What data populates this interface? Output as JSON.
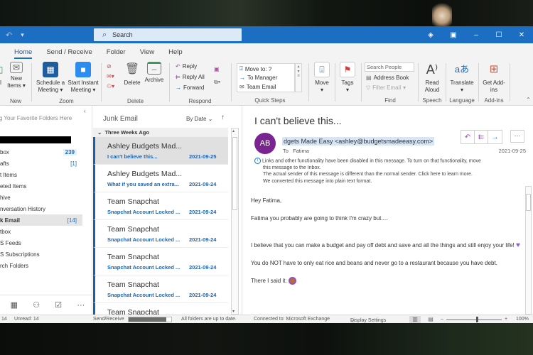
{
  "titlebar": {
    "search_placeholder": "Search",
    "icons": [
      "undo-icon",
      "customize-toolbar-icon",
      "diamond-icon",
      "ribbon-display-icon",
      "minimize-icon",
      "maximize-icon",
      "close-icon"
    ]
  },
  "tabs": [
    {
      "label": "Home",
      "active": true
    },
    {
      "label": "Send / Receive",
      "active": false
    },
    {
      "label": "Folder",
      "active": false
    },
    {
      "label": "View",
      "active": false
    },
    {
      "label": "Help",
      "active": false
    }
  ],
  "ribbon": {
    "new": {
      "group": "New",
      "new_items": "New Items",
      "new_email_partial": "l"
    },
    "zoom": {
      "group": "Zoom",
      "schedule": "Schedule a Meeting",
      "start_instant": "Start Instant Meeting"
    },
    "delete": {
      "group": "Delete",
      "delete": "Delete",
      "archive": "Archive"
    },
    "respond": {
      "group": "Respond",
      "reply": "Reply",
      "reply_all": "Reply All",
      "forward": "Forward"
    },
    "quick_steps": {
      "group": "Quick Steps",
      "items": [
        "Move to: ?",
        "To Manager",
        "Team Email"
      ]
    },
    "move": {
      "label": "Move"
    },
    "tags": {
      "label": "Tags"
    },
    "find": {
      "group": "Find",
      "search_people": "Search People",
      "address_book": "Address Book",
      "filter_email": "Filter Email"
    },
    "speech": {
      "group": "Speech",
      "read_aloud": "Read Aloud"
    },
    "language": {
      "group": "Language",
      "translate": "Translate"
    },
    "addins": {
      "group": "Add-ins",
      "get_addins": "Get Add-ins"
    }
  },
  "folders": {
    "favorites_hint": "Drag Your Favorite Folders Here",
    "items": [
      {
        "label": "Inbox",
        "count": "239",
        "selected": false
      },
      {
        "label": "Drafts",
        "count": "[1]",
        "selected": false
      },
      {
        "label": "Sent Items",
        "count": "",
        "selected": false
      },
      {
        "label": "Deleted Items",
        "count": "",
        "selected": false
      },
      {
        "label": "Archive",
        "count": "",
        "selected": false
      },
      {
        "label": "Conversation History",
        "count": "",
        "selected": false
      },
      {
        "label": "Junk Email",
        "count": "[14]",
        "selected": true
      },
      {
        "label": "Outbox",
        "count": "",
        "selected": false
      },
      {
        "label": "RSS Feeds",
        "count": "",
        "selected": false
      },
      {
        "label": "RSS Subscriptions",
        "count": "",
        "selected": false
      },
      {
        "label": "Search Folders",
        "count": "",
        "selected": false
      }
    ],
    "visible_labels": [
      "box",
      "afts",
      "t Items",
      "eted Items",
      "hive",
      "nversation History",
      "k Email",
      "tbox",
      "S Feeds",
      "S Subscriptions",
      "rch Folders"
    ]
  },
  "message_list": {
    "folder_title": "Junk Email",
    "sort": "By Date",
    "group": "Three Weeks Ago",
    "items": [
      {
        "from": "Ashley Budgets Mad...",
        "subject": "I can't believe this...",
        "date": "2021-09-25",
        "selected": true
      },
      {
        "from": "Ashley Budgets Mad...",
        "subject": "What if you saved an extra...",
        "date": "2021-09-24",
        "selected": false
      },
      {
        "from": "Team Snapchat",
        "subject": "Snapchat Account Locked ...",
        "date": "2021-09-24",
        "selected": false
      },
      {
        "from": "Team Snapchat",
        "subject": "Snapchat Account Locked ...",
        "date": "2021-09-24",
        "selected": false
      },
      {
        "from": "Team Snapchat",
        "subject": "Snapchat Account Locked ...",
        "date": "2021-09-24",
        "selected": false
      },
      {
        "from": "Team Snapchat",
        "subject": "Snapchat Account Locked ...",
        "date": "2021-09-24",
        "selected": false
      },
      {
        "from": "Team Snapchat",
        "subject": "",
        "date": "",
        "selected": false
      }
    ]
  },
  "reading": {
    "subject": "I can't believe this...",
    "avatar_initials": "AB",
    "avatar_color": "#7a2491",
    "from": "dgets Made Easy <ashley@budgetsmadeeasy.com>",
    "to_label": "To",
    "to": "Fatima",
    "date": "2021-09-25",
    "info": [
      "Links and other functionality have been disabled in this message. To turn on that functionality, move",
      "this message to the Inbox.",
      "The actual sender of this message is different than the normal sender. Click here to learn more.",
      "We converted this message into plain text format."
    ],
    "body": [
      "Hey Fatima,",
      "Fatima you probably are going to think I'm crazy but....",
      "I believe that you can make a budget and pay off debt and save and all the things and still enjoy your life!",
      "You do NOT have to only eat rice and beans and never go to a restaurant because you have debt.",
      "There I said it."
    ]
  },
  "status": {
    "items": "14",
    "unread": "Unread: 14",
    "send_receive": "Send/Receive",
    "send_receive_progress": 0.88,
    "folders_status": "All folders are up to date.",
    "connection": "Connected to: Microsoft Exchange",
    "display_settings": "Display Settings",
    "zoom": "100%",
    "zoom_level": 0.55
  },
  "colors": {
    "accent": "#1c6ec2",
    "link_blue": "#1c65b5",
    "avatar": "#7a2491"
  }
}
